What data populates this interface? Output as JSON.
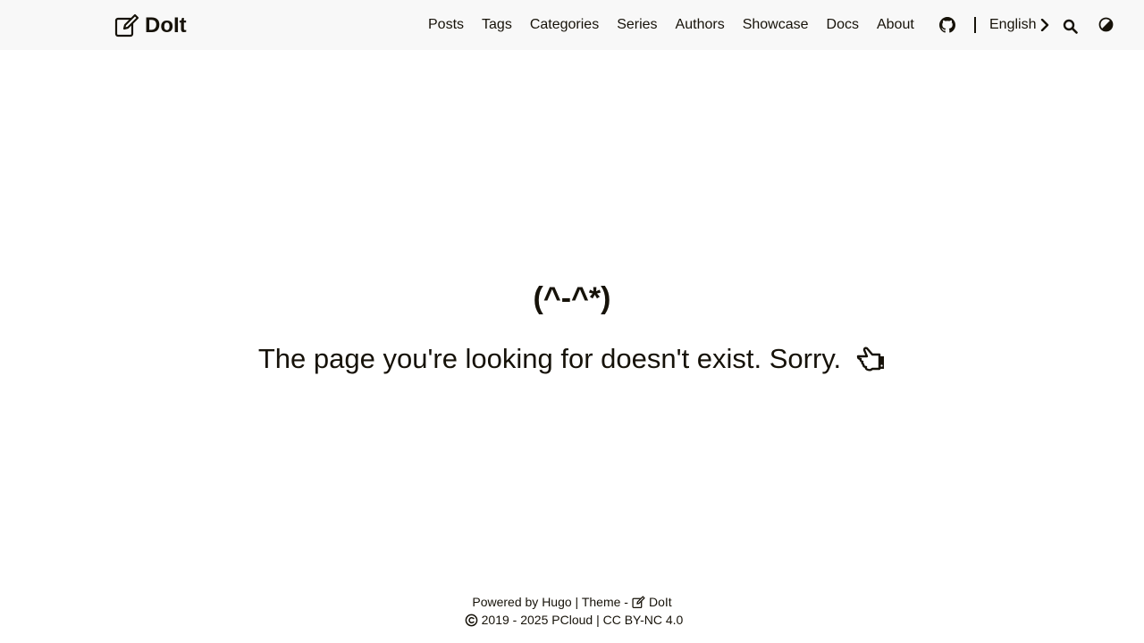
{
  "header": {
    "logo_text": "DoIt",
    "nav": [
      "Posts",
      "Tags",
      "Categories",
      "Series",
      "Authors",
      "Showcase",
      "Docs",
      "About"
    ],
    "language": "English",
    "icons": {
      "logo": "pen-to-square-icon",
      "github": "github-icon",
      "language_arrow": "chevron-right-icon",
      "search": "search-icon",
      "theme": "theme-toggle-icon"
    }
  },
  "main": {
    "face": "(^-^*)",
    "message": "The page you're looking for doesn't exist. Sorry.",
    "message_icon": "pointing-hand-icon"
  },
  "footer": {
    "powered_by": "Powered by",
    "hugo": "Hugo",
    "theme_sep": "| Theme -",
    "theme_name": "DoIt",
    "copyright_icon": "copyright-icon",
    "years": "2019 - 2025",
    "owner": "PCloud",
    "license_sep": "|",
    "license": "CC BY-NC 4.0"
  },
  "colors": {
    "text": "#161209",
    "header_bg": "#f8f8f8",
    "background": "#ffffff"
  }
}
